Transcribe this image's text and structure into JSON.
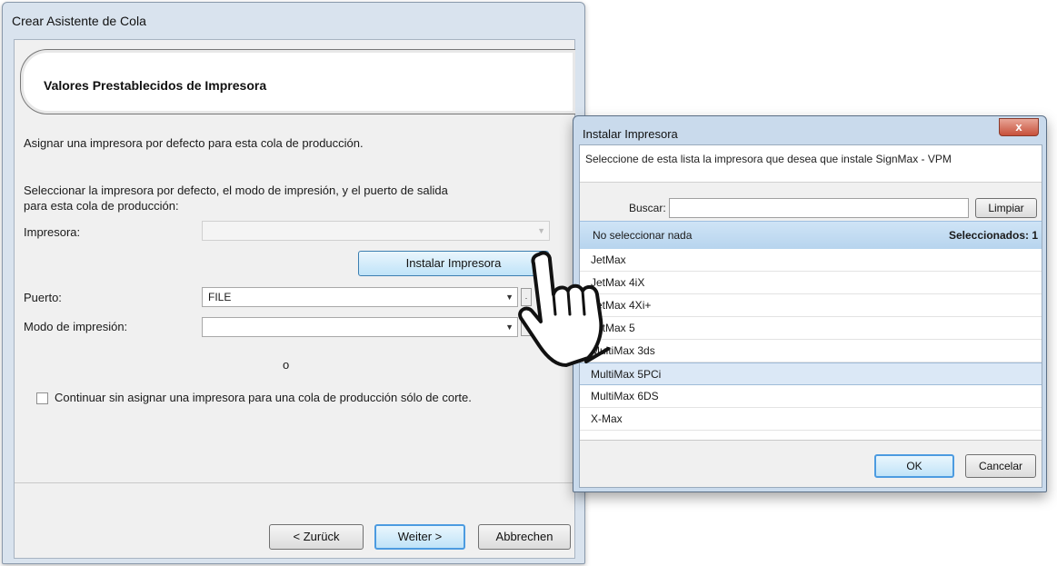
{
  "wizard": {
    "title": "Crear Asistente de Cola",
    "header": "Valores Prestablecidos de Impresora",
    "description": "Asignar una impresora por defecto para esta cola de producción.",
    "instructions_line1": "Seleccionar la impresora por defecto, el modo de impresión, y el puerto de salida",
    "instructions_line2": "para esta cola de producción:",
    "printer_label": "Impresora:",
    "printer_value": "",
    "install_button": "Instalar Impresora",
    "port_label": "Puerto:",
    "port_value": "FILE",
    "mode_label": "Modo de impresión:",
    "mode_value": "",
    "or_text": "o",
    "cut_only_checkbox_label": "Continuar sin asignar una impresora para una cola de producción sólo de corte.",
    "back_button": "< Zurück",
    "next_button": "Weiter >",
    "cancel_button": "Abbrechen"
  },
  "install_dialog": {
    "title": "Instalar Impresora",
    "close": "x",
    "instruction": "Seleccione de esta lista la impresora que desea que instale SignMax - VPM",
    "search_label": "Buscar:",
    "search_value": "",
    "clear_button": "Limpiar",
    "select_none": "No seleccionar nada",
    "selected_count": "Seleccionados: 1",
    "printers": [
      "JetMax",
      "JetMax 4iX",
      "JetMax 4Xi+",
      "JetMax 5",
      "MultiMax 3ds",
      "MultiMax 5PCi",
      "MultiMax 6DS",
      "X-Max"
    ],
    "selected_printer": "MultiMax 5PCi",
    "ok_button": "OK",
    "cancel_button": "Cancelar"
  },
  "colors": {
    "window_frame": "#d9e3ee",
    "dialog_frame": "#c9daec",
    "selection": "#dbe8f6",
    "list_header": "#cfe4f6",
    "close_red": "#c7503a"
  },
  "icons": [
    "dropdown-arrow-icon",
    "close-icon",
    "hand-pointer-icon",
    "checkbox-icon"
  ]
}
